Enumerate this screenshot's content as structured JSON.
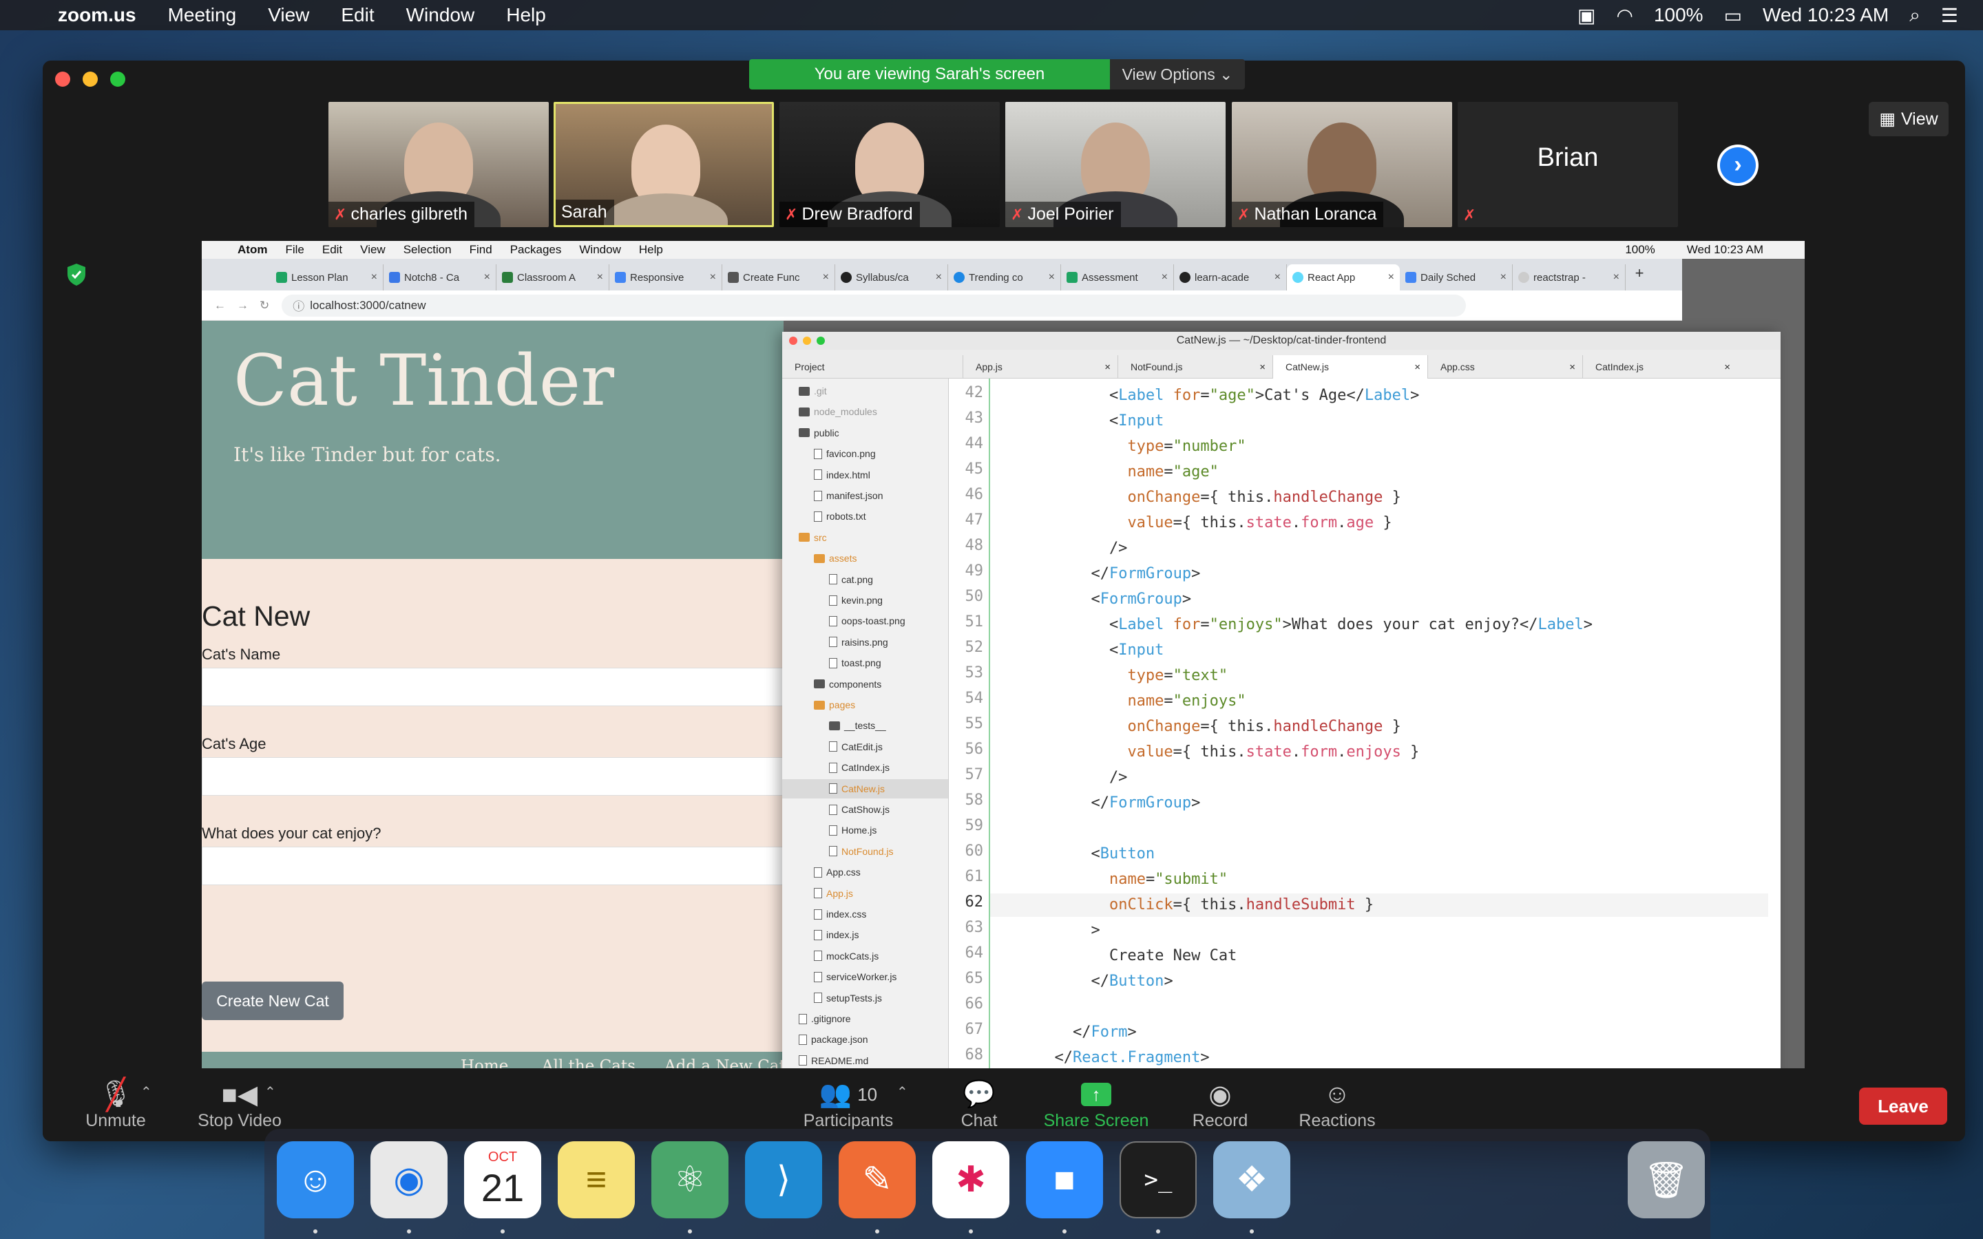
{
  "menubar": {
    "app": "zoom.us",
    "items": [
      "Meeting",
      "View",
      "Edit",
      "Window",
      "Help"
    ],
    "battery": "100%",
    "datetime": "Wed 10:23 AM"
  },
  "zoom": {
    "banner": "You are viewing Sarah's screen",
    "view_options": "View Options",
    "view_button": "View",
    "participants": [
      {
        "name": "charles gilbreth",
        "muted": true
      },
      {
        "name": "Sarah",
        "muted": false
      },
      {
        "name": "Drew Bradford",
        "muted": true
      },
      {
        "name": "Joel Poirier",
        "muted": true
      },
      {
        "name": "Nathan Loranca",
        "muted": true
      },
      {
        "name": "Brian",
        "muted": true
      }
    ],
    "toolbar": {
      "unmute": "Unmute",
      "stop_video": "Stop Video",
      "participants_count": "10",
      "participants": "Participants",
      "chat": "Chat",
      "share_screen": "Share Screen",
      "record": "Record",
      "reactions": "Reactions",
      "leave": "Leave"
    }
  },
  "shared": {
    "menubar": {
      "app": "Atom",
      "items": [
        "File",
        "Edit",
        "View",
        "Selection",
        "Find",
        "Packages",
        "Window",
        "Help"
      ],
      "battery": "100%",
      "datetime": "Wed 10:23 AM"
    },
    "chrome": {
      "tabs": [
        "Lesson Plan",
        "Notch8 - Ca",
        "Classroom A",
        "Responsive",
        "Create Func",
        "Syllabus/ca",
        "Trending co",
        "Assessment",
        "learn-acade",
        "React App",
        "Daily Sched",
        "reactstrap -"
      ],
      "active_tab": 9,
      "url": "localhost:3000/catnew"
    },
    "page": {
      "title": "Cat Tinder",
      "subtitle": "It's like Tinder but for cats.",
      "form_title": "Cat New",
      "labels": [
        "Cat's Name",
        "Cat's Age",
        "What does your cat enjoy?"
      ],
      "button": "Create New Cat",
      "footer_links": [
        "Home",
        "All the Cats",
        "Add a New Cat"
      ]
    },
    "atom": {
      "title": "CatNew.js — ~/Desktop/cat-tinder-frontend",
      "tree_header": "Project",
      "tabs": [
        "App.js",
        "NotFound.js",
        "CatNew.js",
        "App.css",
        "CatIndex.js"
      ],
      "active_tab": 2,
      "tree": [
        {
          "name": ".git",
          "type": "folder",
          "depth": 0,
          "dim": true
        },
        {
          "name": "node_modules",
          "type": "folder",
          "depth": 0,
          "dim": true
        },
        {
          "name": "public",
          "type": "folder",
          "depth": 0
        },
        {
          "name": "favicon.png",
          "type": "file",
          "depth": 1
        },
        {
          "name": "index.html",
          "type": "file",
          "depth": 1
        },
        {
          "name": "manifest.json",
          "type": "file",
          "depth": 1
        },
        {
          "name": "robots.txt",
          "type": "file",
          "depth": 1
        },
        {
          "name": "src",
          "type": "folder",
          "depth": 0,
          "orange": true
        },
        {
          "name": "assets",
          "type": "folder",
          "depth": 1,
          "orange": true
        },
        {
          "name": "cat.png",
          "type": "file",
          "depth": 2
        },
        {
          "name": "kevin.png",
          "type": "file",
          "depth": 2
        },
        {
          "name": "oops-toast.png",
          "type": "file",
          "depth": 2
        },
        {
          "name": "raisins.png",
          "type": "file",
          "depth": 2
        },
        {
          "name": "toast.png",
          "type": "file",
          "depth": 2
        },
        {
          "name": "components",
          "type": "folder",
          "depth": 1
        },
        {
          "name": "pages",
          "type": "folder",
          "depth": 1,
          "orange": true
        },
        {
          "name": "__tests__",
          "type": "folder",
          "depth": 2
        },
        {
          "name": "CatEdit.js",
          "type": "file",
          "depth": 2
        },
        {
          "name": "CatIndex.js",
          "type": "file",
          "depth": 2
        },
        {
          "name": "CatNew.js",
          "type": "file",
          "depth": 2,
          "orange": true,
          "selected": true
        },
        {
          "name": "CatShow.js",
          "type": "file",
          "depth": 2
        },
        {
          "name": "Home.js",
          "type": "file",
          "depth": 2
        },
        {
          "name": "NotFound.js",
          "type": "file",
          "depth": 2,
          "orange": true
        },
        {
          "name": "App.css",
          "type": "file",
          "depth": 1
        },
        {
          "name": "App.js",
          "type": "file",
          "depth": 1,
          "orange": true
        },
        {
          "name": "index.css",
          "type": "file",
          "depth": 1
        },
        {
          "name": "index.js",
          "type": "file",
          "depth": 1
        },
        {
          "name": "mockCats.js",
          "type": "file",
          "depth": 1
        },
        {
          "name": "serviceWorker.js",
          "type": "file",
          "depth": 1
        },
        {
          "name": "setupTests.js",
          "type": "file",
          "depth": 1
        },
        {
          "name": ".gitignore",
          "type": "file",
          "depth": 0
        },
        {
          "name": "package.json",
          "type": "file",
          "depth": 0
        },
        {
          "name": "README.md",
          "type": "file",
          "depth": 0
        }
      ],
      "first_line": 42,
      "current_line": 62,
      "code": [
        "            <Label for=\"age\">Cat's Age</Label>",
        "            <Input",
        "              type=\"number\"",
        "              name=\"age\"",
        "              onChange={ this.handleChange }",
        "              value={ this.state.form.age }",
        "            />",
        "          </FormGroup>",
        "          <FormGroup>",
        "            <Label for=\"enjoys\">What does your cat enjoy?</Label>",
        "            <Input",
        "              type=\"text\"",
        "              name=\"enjoys\"",
        "              onChange={ this.handleChange }",
        "              value={ this.state.form.enjoys }",
        "            />",
        "          </FormGroup>",
        "",
        "          <Button",
        "            name=\"submit\"",
        "            onClick={ this.handleSubmit }",
        "          >",
        "            Create New Cat",
        "          </Button>",
        "",
        "        </Form>",
        "      </React.Fragment>",
        "    )",
        "  }"
      ]
    }
  },
  "dock": {
    "apps": [
      {
        "name": "Finder",
        "icon": "finder-icon",
        "color": "#2d8cf0",
        "running": true
      },
      {
        "name": "Chrome",
        "icon": "chrome-icon",
        "color": "#e8e8e8",
        "running": true
      },
      {
        "name": "Calendar",
        "icon": "calendar-icon",
        "color": "#ffffff",
        "running": true,
        "month": "OCT",
        "day": "21"
      },
      {
        "name": "Notes",
        "icon": "notes-icon",
        "color": "#f7e27a",
        "running": false
      },
      {
        "name": "Atom",
        "icon": "atom-icon",
        "color": "#4aa66b",
        "running": true
      },
      {
        "name": "VS Code",
        "icon": "vscode-icon",
        "color": "#1f8ad2",
        "running": false
      },
      {
        "name": "Postman",
        "icon": "postman-icon",
        "color": "#ef6c35",
        "running": true
      },
      {
        "name": "Slack",
        "icon": "slack-icon",
        "color": "#ffffff",
        "running": true
      },
      {
        "name": "Zoom",
        "icon": "zoom-icon",
        "color": "#2d8cff",
        "running": true
      },
      {
        "name": "Terminal",
        "icon": "terminal-icon",
        "color": "#1e1e1e",
        "running": true
      },
      {
        "name": "Preview",
        "icon": "preview-icon",
        "color": "#8ab4d8",
        "running": true
      }
    ]
  }
}
